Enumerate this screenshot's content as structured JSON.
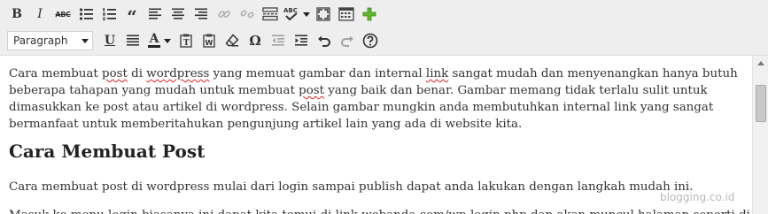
{
  "toolbar": {
    "format_select_value": "Paragraph",
    "bold_label": "B",
    "italic_label": "I",
    "strike_label": "ABC",
    "blockquote_label": "“",
    "underline_label": "U",
    "text_color_label": "A",
    "special_char_label": "Ω",
    "accent_color": "#5cb82c",
    "icons": [
      "bold-icon",
      "italic-icon",
      "strikethrough-icon",
      "bullet-list-icon",
      "numbered-list-icon",
      "blockquote-icon",
      "align-left-icon",
      "align-center-icon",
      "align-right-icon",
      "link-icon",
      "unlink-icon",
      "more-tag-icon",
      "spellcheck-icon",
      "fullscreen-icon",
      "kitchen-sink-icon",
      "add-media-icon",
      "underline-icon",
      "justify-icon",
      "text-color-icon",
      "paste-text-icon",
      "paste-word-icon",
      "clear-formatting-icon",
      "special-char-icon",
      "outdent-icon",
      "indent-icon",
      "undo-icon",
      "redo-icon",
      "help-icon"
    ]
  },
  "content": {
    "paragraph1": {
      "segments": [
        {
          "text": "Cara membuat ",
          "spell": false
        },
        {
          "text": "post",
          "spell": true
        },
        {
          "text": " di ",
          "spell": false
        },
        {
          "text": "wordpress",
          "spell": true
        },
        {
          "text": " yang memuat gambar dan internal ",
          "spell": false
        },
        {
          "text": "link",
          "spell": true
        },
        {
          "text": " sangat mudah dan menyenangkan hanya butuh beberapa tahapan yang mudah untuk membuat ",
          "spell": false
        },
        {
          "text": "post",
          "spell": true
        },
        {
          "text": " yang baik dan benar. Gambar memang tidak terlalu sulit untuk dimasukkan ke post atau artikel di wordpress. Selain gambar mungkin anda membutuhkan internal link yang sangat bermanfaat untuk memberitahukan pengunjung artikel lain yang ada di website kita.",
          "spell": false
        }
      ]
    },
    "heading": "Cara Membuat Post",
    "paragraph2": "Cara membuat post di wordpress mulai dari login sampai publish dapat anda lakukan dengan langkah mudah ini.",
    "paragraph3": "Masuk ke menu login biasanya ini dapat kita temui di link webanda.com/wp-login.php dan akan muncul halaman seperti di bawah ini."
  },
  "watermark": "blogging.co.id"
}
